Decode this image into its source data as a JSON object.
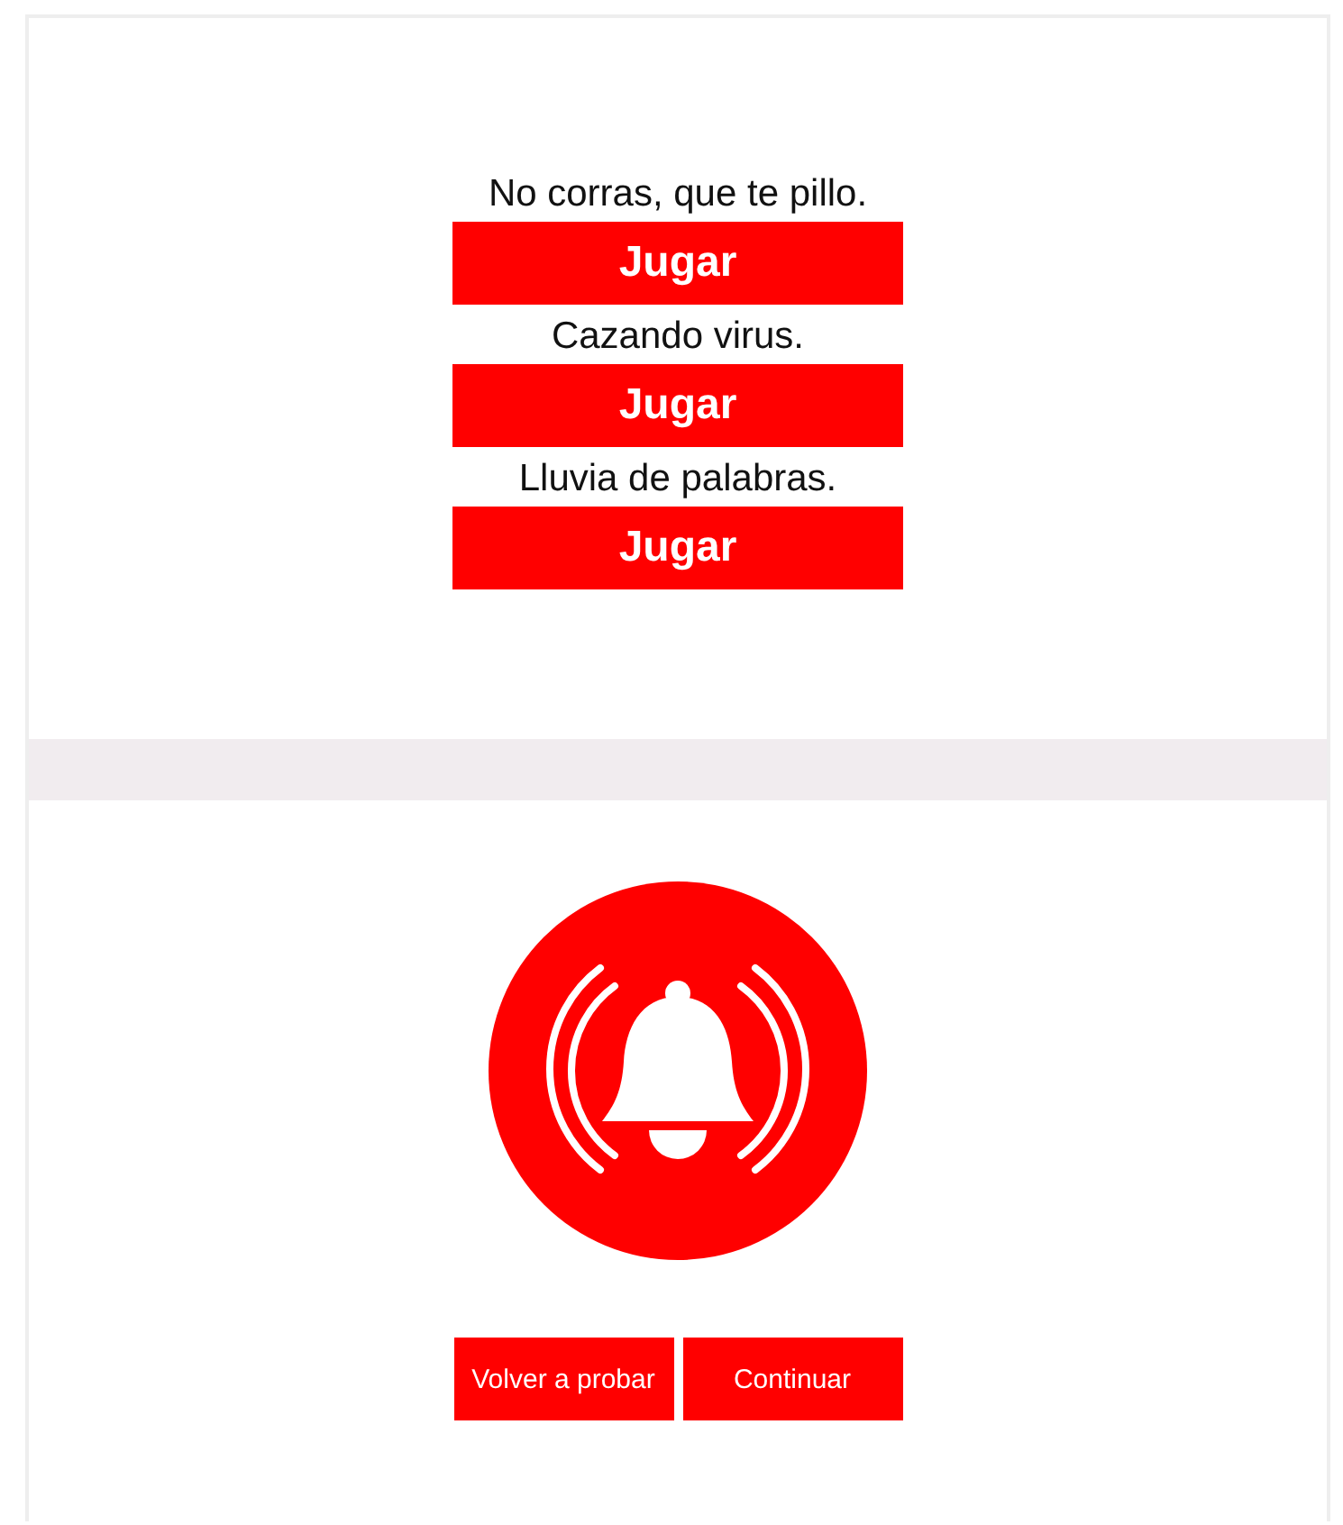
{
  "games": [
    {
      "title": "No corras, que te pillo.",
      "button": "Jugar"
    },
    {
      "title": "Cazando virus.",
      "button": "Jugar"
    },
    {
      "title": "Lluvia de palabras.",
      "button": "Jugar"
    }
  ],
  "alert": {
    "buttons": [
      "Volver a probar",
      "Continuar"
    ]
  }
}
